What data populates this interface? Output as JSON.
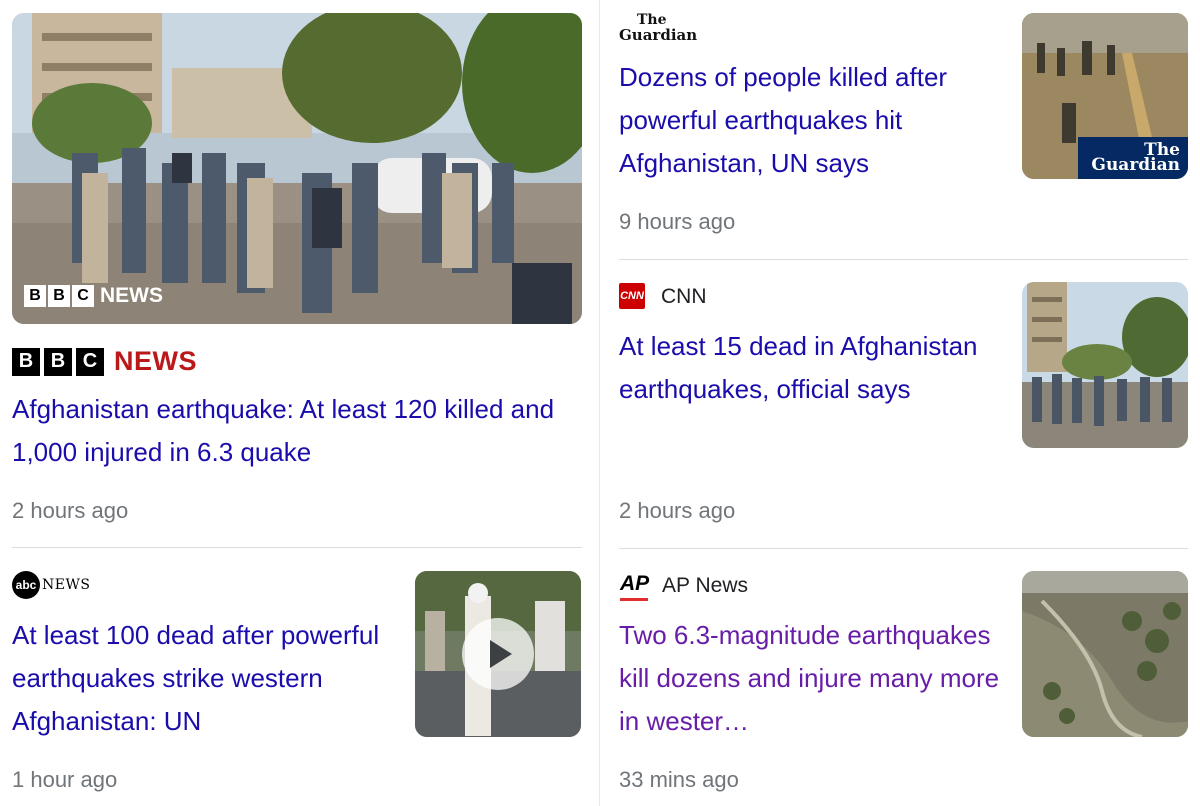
{
  "stories": [
    {
      "source": "BBC News",
      "logo_letters": [
        "B",
        "B",
        "C"
      ],
      "logo_word": "NEWS",
      "headline": "Afghanistan earthquake: At least 120 killed and 1,000 injured in 6.3 quake",
      "time": "2 hours ago",
      "image_icon": "crowd-street-photo"
    },
    {
      "source": "The Guardian",
      "logo_top": "The",
      "logo_bottom": "Guardian",
      "headline": "Dozens of people killed after powerful earthquakes hit Afghanistan, UN says",
      "time": "9 hours ago",
      "image_icon": "rescue-workers-photo"
    },
    {
      "source": "CNN",
      "logo_text": "CNN",
      "headline": "At least 15 dead in Afghanistan earthquakes, official says",
      "time": "2 hours ago",
      "image_icon": "crowd-street-photo"
    },
    {
      "source": "ABC News",
      "logo_circle": "abc",
      "logo_word": "NEWS",
      "headline": "At least 100 dead after powerful earthquakes strike western Afghanistan: UN",
      "time": "1 hour ago",
      "image_icon": "video-play-icon"
    },
    {
      "source": "AP News",
      "logo_text": "AP",
      "headline": "Two 6.3-magnitude earthquakes kill dozens and injure many more in wester…",
      "time": "33 mins ago",
      "image_icon": "aerial-landscape-photo"
    }
  ],
  "colors": {
    "link": "#1a0dab",
    "visited": "#681da8",
    "meta": "#70757a",
    "bbc_red": "#bb1919",
    "cnn_red": "#cc0000",
    "guardian_blue": "#052962"
  }
}
